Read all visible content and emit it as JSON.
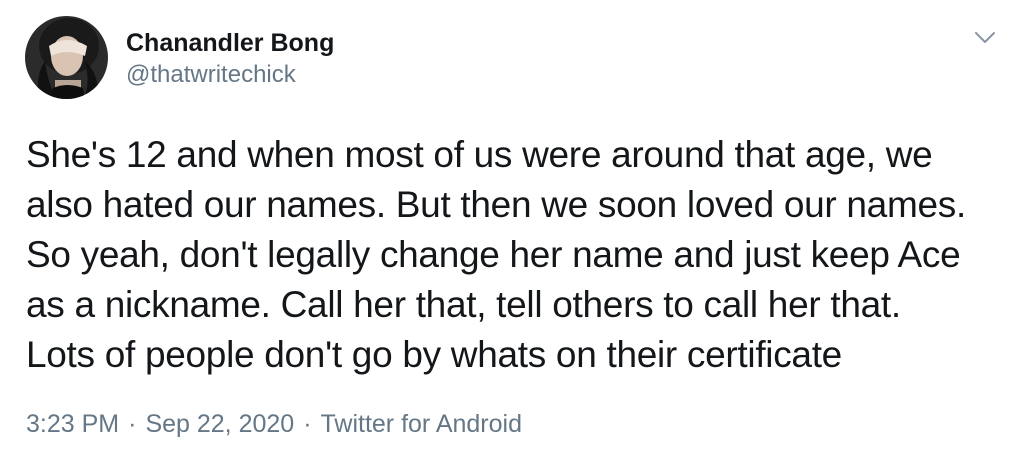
{
  "user": {
    "display_name": "Chanandler Bong",
    "handle": "@thatwritechick"
  },
  "tweet": {
    "lines": [
      "She's 12 and when most of us were around that age, we",
      "also hated our names. But then we soon loved our names.",
      "So yeah, don't legally change her name and just keep Ace",
      "as a nickname. Call her that, tell others to call her that.",
      "Lots of people don't go by whats on their certificate"
    ]
  },
  "meta": {
    "time": "3:23 PM",
    "separator": "·",
    "date": "Sep 22, 2020",
    "source": "Twitter for Android"
  },
  "icons": {
    "menu": "chevron-down-icon"
  },
  "colors": {
    "text": "#14171a",
    "secondary": "#657786"
  }
}
